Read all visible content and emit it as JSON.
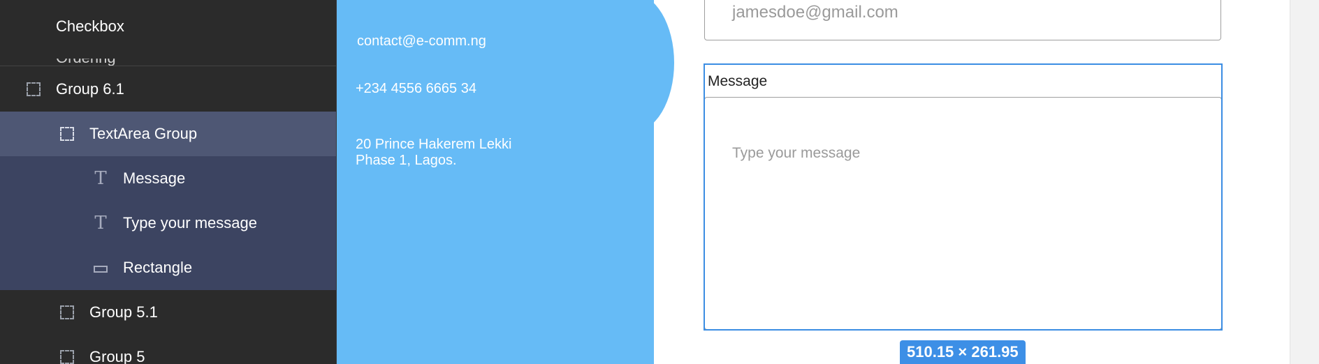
{
  "layers": {
    "items": [
      {
        "label": "Checkbox",
        "type": "component",
        "selected": false
      },
      {
        "label": "Group 6.1",
        "type": "group",
        "selected": false
      },
      {
        "label": "TextArea Group",
        "type": "group",
        "selected": true
      },
      {
        "label": "Message",
        "type": "text",
        "selected": false
      },
      {
        "label": "Type your message",
        "type": "text",
        "selected": false
      },
      {
        "label": "Rectangle",
        "type": "rectangle",
        "selected": false
      },
      {
        "label": "Group 5.1",
        "type": "group",
        "selected": false
      },
      {
        "label": "Group 5",
        "type": "group",
        "selected": false
      }
    ]
  },
  "contact": {
    "email": "contact@e-comm.ng",
    "phone": "+234 4556 6665 34",
    "address_line1": "20 Prince Hakerem Lekki",
    "address_line2": "Phase 1, Lagos."
  },
  "form": {
    "email_value": "jamesdoe@gmail.com",
    "message_label": "Message",
    "message_placeholder": "Type your message"
  },
  "selection": {
    "size_readout": "510.15 × 261.95"
  },
  "colors": {
    "panel_bg": "#2b2b2b",
    "selected_row": "#4e5774",
    "child_row": "#3c4461",
    "contact_blue": "#66bbf6",
    "selection_blue": "#3b8de3"
  },
  "icons": {
    "group": "dashed-square-icon",
    "text": "text-t-icon",
    "rectangle": "rectangle-icon"
  }
}
